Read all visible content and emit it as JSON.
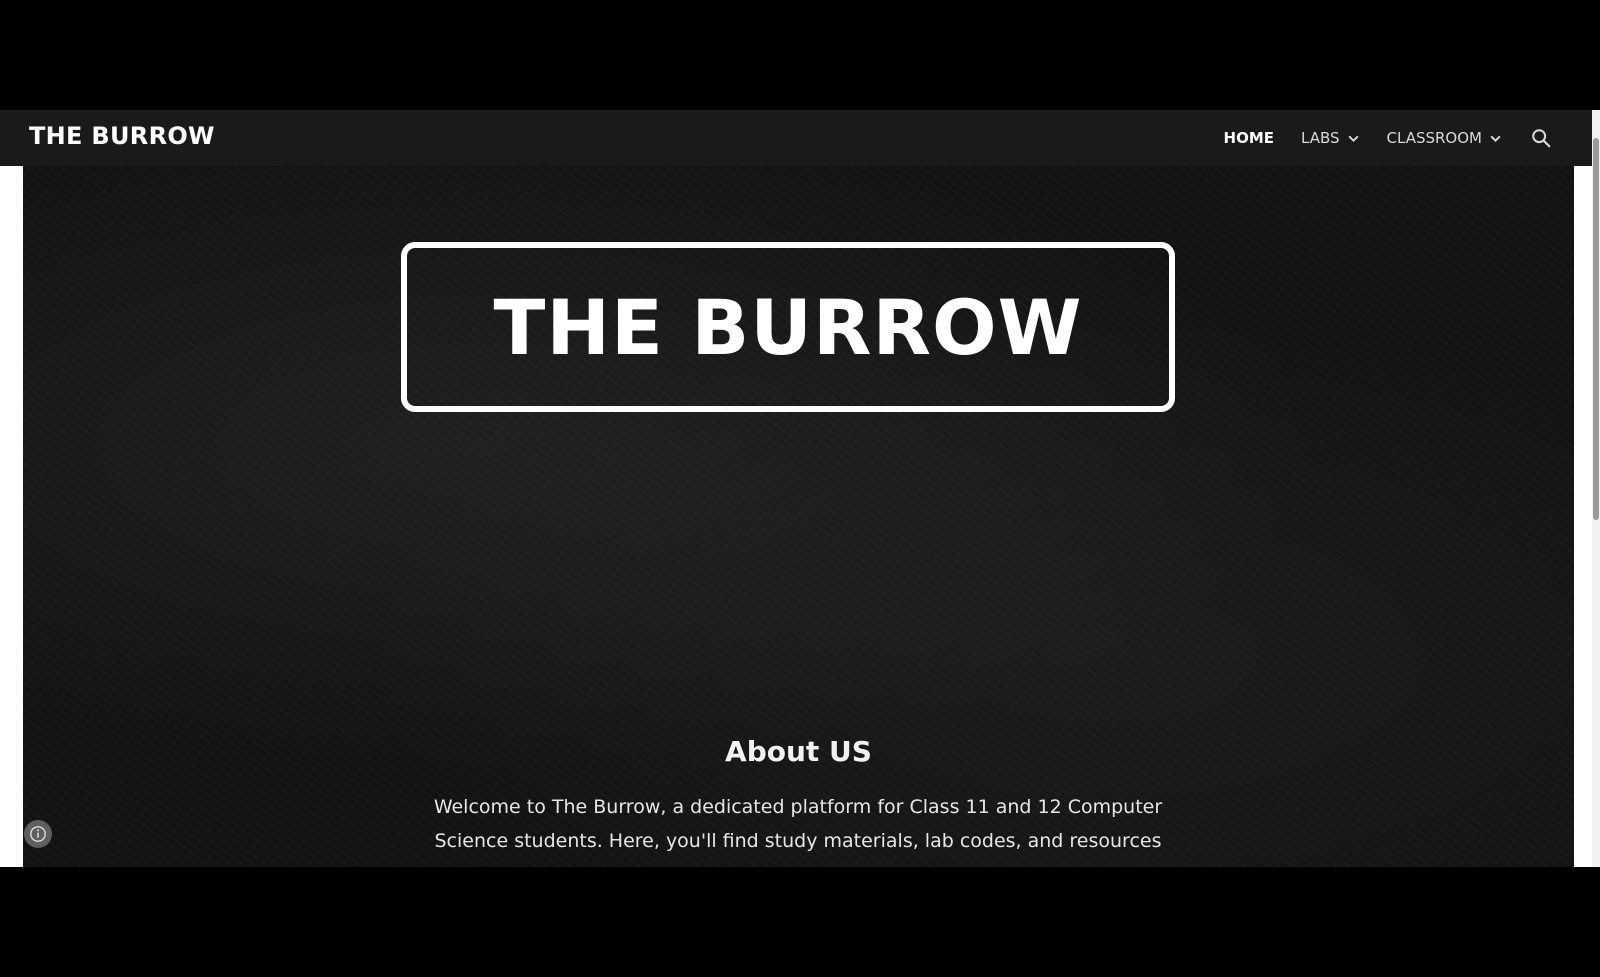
{
  "navbar": {
    "brand": "THE BURROW",
    "items": [
      {
        "label": "HOME",
        "active": true,
        "dropdown": false
      },
      {
        "label": "LABS",
        "active": false,
        "dropdown": true
      },
      {
        "label": "CLASSROOM",
        "active": false,
        "dropdown": true
      }
    ],
    "search_icon": "search-icon"
  },
  "hero": {
    "title": "THE BURROW"
  },
  "about": {
    "heading": "About US",
    "text": "Welcome to The Burrow, a dedicated platform for Class 11 and 12 Computer Science students. Here, you'll find study materials, lab codes, and resources designed to"
  },
  "colors": {
    "navbar_bg": "#1a1a1b",
    "hero_bg": "#121212",
    "text": "#ffffff"
  }
}
